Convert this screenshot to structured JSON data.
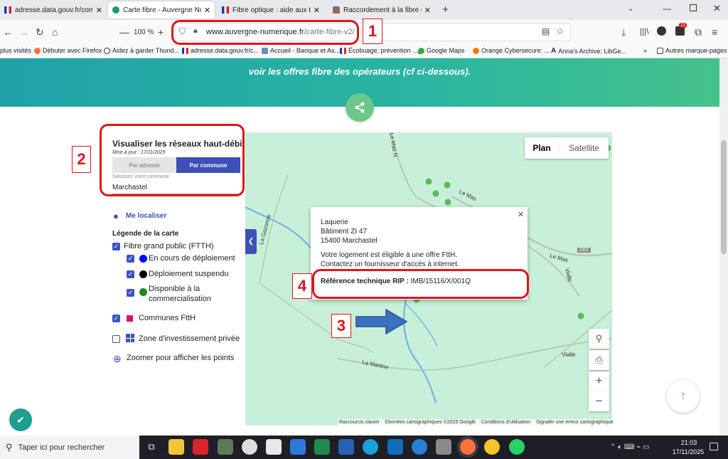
{
  "browser": {
    "tabs": [
      {
        "label": "adresse.data.gouv.fr/commune/",
        "icon": "france-flag-icon"
      },
      {
        "label": "Carte fibre - Auvergne Numériq",
        "icon": "auvergne-icon",
        "active": true
      },
      {
        "label": "Fibre optique : aide aux travaux",
        "icon": "france-flag-icon"
      },
      {
        "label": "Raccordement à la fibre optique",
        "icon": "photo-icon"
      }
    ],
    "zoom": "100 %",
    "url_domain": "www.auvergne-numerique.fr",
    "url_path": "/carte-fibre-v2/",
    "notif_count": "11",
    "bookmarks": [
      "plus visités",
      "Débuter avec Firefox",
      "Aidez à garder Thund...",
      "adresse.data.gouv.fr/c...",
      "Accueil - Banque et As...",
      "Écobuage, prévention ...",
      "Google Maps",
      "Orange Cybersecure: ...",
      "Anna's Archive: LibGe...",
      "Autres marque-pages"
    ]
  },
  "page": {
    "banner_text": "voir les offres fibre des opérateurs (cf ci-dessous).",
    "panel": {
      "title": "Visualiser les réseaux haut-débits",
      "updated": "Mise à jour : 17/11/2025",
      "toggle": {
        "address": "Par adresse",
        "commune": "Par commune"
      },
      "commune_label": "Saisissez votre commune",
      "commune_value": "Marchastel",
      "locate": "Me localiser",
      "legend_title": "Légende de la carte",
      "legend": {
        "ftth": "Fibre grand public (FTTH)",
        "deploying": "En cours de déploiement",
        "suspended": "Déploiement suspendu",
        "available_1": "Disponible à la",
        "available_2": "commercialisation",
        "communes": "Communes FttH",
        "private": "Zone d'investissement privée",
        "zoom": "Zoomer pour afficher les points"
      },
      "colors": {
        "deploying": "#0000ff",
        "suspended": "#000000",
        "available": "#1a8c1a",
        "communes": "#e0106a"
      }
    },
    "map": {
      "type_plan": "Plan",
      "type_satellite": "Satellite",
      "labels": [
        "Le Mas N",
        "Le Mas",
        "La Gazonne",
        "Le Mas",
        "D62",
        "Vialle",
        "Vialle",
        "La Martine"
      ],
      "popup": {
        "name": "Laquerie",
        "building": "Bâtiment ZI 47",
        "postal": "15400 Marchastel",
        "eligible_1": "Votre logement est éligible à une offre FttH.",
        "eligible_2": "Contactez un fournisseur d'accès à internet.",
        "ref_label": "Référence technique RIP :",
        "ref_value": "IMB/15116/X/001Q"
      },
      "attribution": [
        "Raccourcis clavier",
        "Données cartographiques ©2025 Google",
        "Conditions d'utilisation",
        "Signaler une erreur cartographique"
      ]
    },
    "annotations": [
      "1",
      "2",
      "3",
      "4"
    ]
  },
  "taskbar": {
    "search_placeholder": "Taper ici pour rechercher",
    "time": "21:03",
    "date": "17/11/2025"
  }
}
